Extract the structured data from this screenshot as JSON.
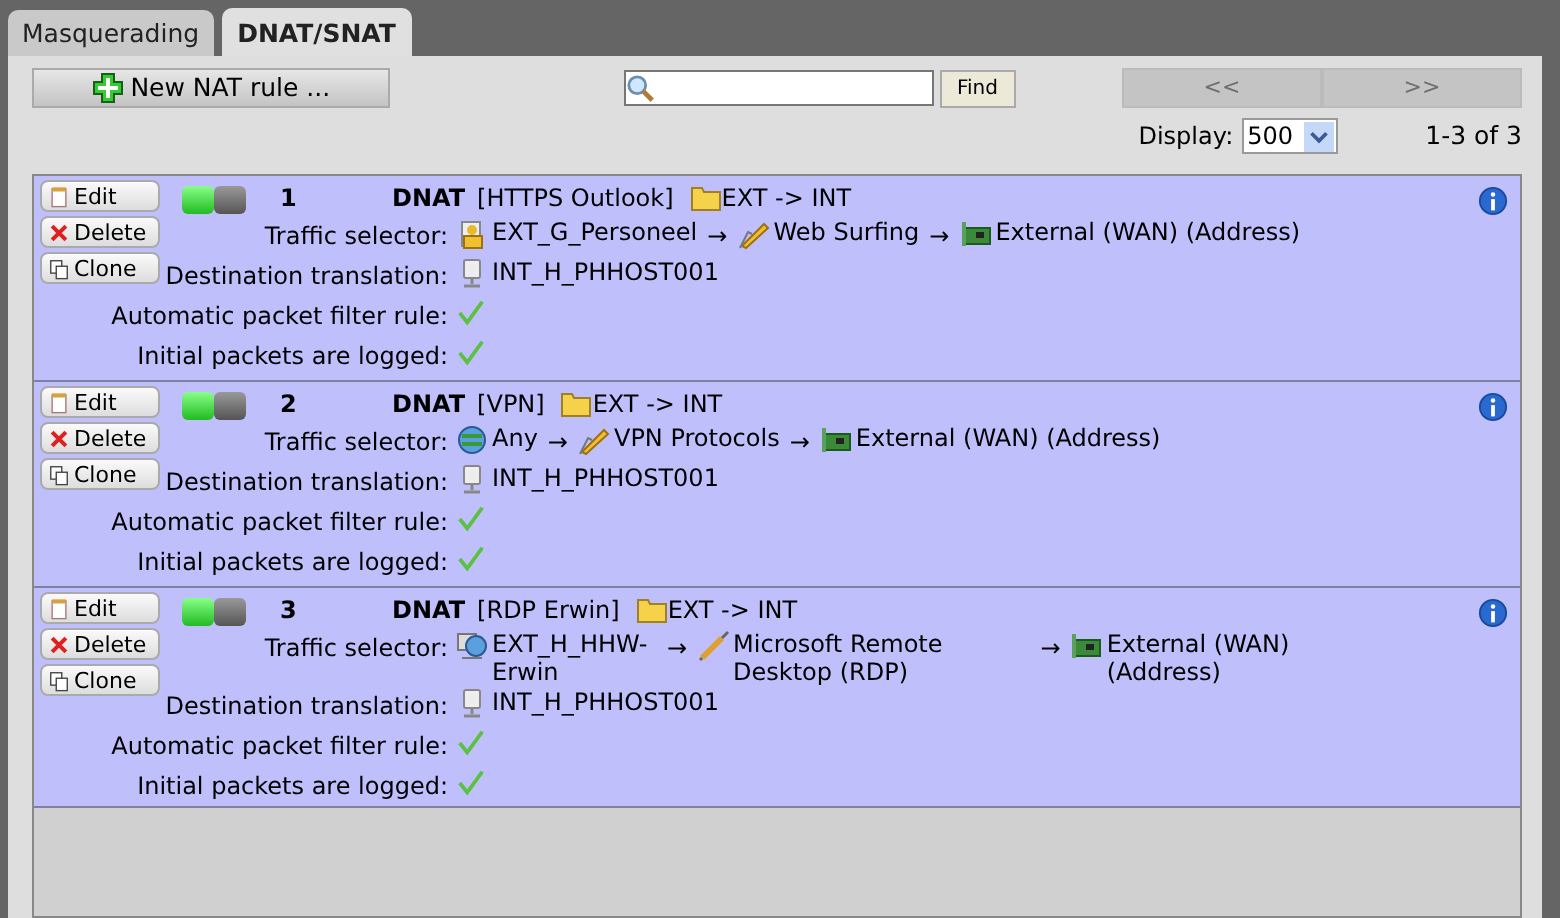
{
  "tabs": [
    {
      "label": "Masquerading",
      "selected": false
    },
    {
      "label": "DNAT/SNAT",
      "selected": true
    }
  ],
  "new_rule_button": "New NAT rule ...",
  "find_button": "Find",
  "pager": [
    {
      "label": "<<",
      "disabled": true
    },
    {
      "label": ">>",
      "disabled": true
    }
  ],
  "display": {
    "label": "Display:",
    "value": "500"
  },
  "range": "1-3 of 3",
  "rules": [
    {
      "actions": [
        {
          "kind": "edit",
          "label": "Edit"
        },
        {
          "kind": "delete",
          "label": "Delete"
        },
        {
          "kind": "clone",
          "label": "Clone"
        }
      ],
      "enabled": true,
      "number": "1",
      "labels": {
        "traffic": "Traffic selector:",
        "destination": "Destination translation:",
        "auto_filter": "Automatic packet filter rule:",
        "logged": "Initial packets are logged:"
      },
      "type": "DNAT",
      "name": "[HTTPS Outlook]",
      "direction": "EXT -> INT",
      "traffic": [
        {
          "kind": "group",
          "text": "EXT_G_Personeel"
        },
        {
          "kind": "arrow",
          "text": "→"
        },
        {
          "kind": "service",
          "text": "Web Surfing"
        },
        {
          "kind": "arrow",
          "text": "→"
        },
        {
          "kind": "interface",
          "text": "External (WAN) (Address)"
        }
      ],
      "destination": {
        "kind": "host",
        "text": "INT_H_PHHOST001"
      },
      "auto_filter": true,
      "logged": true
    },
    {
      "actions": [
        {
          "kind": "edit",
          "label": "Edit"
        },
        {
          "kind": "delete",
          "label": "Delete"
        },
        {
          "kind": "clone",
          "label": "Clone"
        }
      ],
      "enabled": true,
      "number": "2",
      "labels": {
        "traffic": "Traffic selector:",
        "destination": "Destination translation:",
        "auto_filter": "Automatic packet filter rule:",
        "logged": "Initial packets are logged:"
      },
      "type": "DNAT",
      "name": "[VPN]",
      "direction": "EXT -> INT",
      "traffic": [
        {
          "kind": "any",
          "text": "Any"
        },
        {
          "kind": "arrow",
          "text": "→"
        },
        {
          "kind": "service",
          "text": "VPN Protocols"
        },
        {
          "kind": "arrow",
          "text": "→"
        },
        {
          "kind": "interface",
          "text": "External (WAN) (Address)"
        }
      ],
      "destination": {
        "kind": "host",
        "text": "INT_H_PHHOST001"
      },
      "auto_filter": true,
      "logged": true
    },
    {
      "actions": [
        {
          "kind": "edit",
          "label": "Edit"
        },
        {
          "kind": "delete",
          "label": "Delete"
        },
        {
          "kind": "clone",
          "label": "Clone"
        }
      ],
      "enabled": true,
      "number": "3",
      "labels": {
        "traffic": "Traffic selector:",
        "destination": "Destination translation:",
        "auto_filter": "Automatic packet filter rule:",
        "logged": "Initial packets are logged:"
      },
      "type": "DNAT",
      "name": "[RDP Erwin]",
      "direction": "EXT -> INT",
      "traffic": [
        {
          "kind": "network",
          "text": "EXT_H_HHW-Erwin"
        },
        {
          "kind": "arrow",
          "text": "→"
        },
        {
          "kind": "rdp",
          "text": "Microsoft Remote Desktop (RDP)"
        },
        {
          "kind": "arrow",
          "text": "→"
        },
        {
          "kind": "interface",
          "text": "External (WAN) (Address)"
        }
      ],
      "destination": {
        "kind": "host",
        "text": "INT_H_PHHOST001"
      },
      "auto_filter": true,
      "logged": true
    }
  ]
}
